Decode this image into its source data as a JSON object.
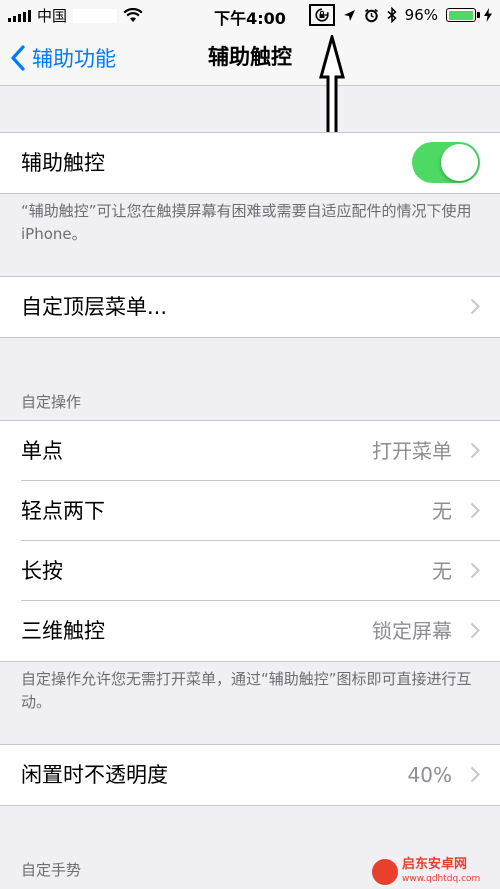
{
  "status_bar": {
    "carrier": "中国",
    "time": "下午4:00",
    "battery_percent": "96%",
    "battery_level": 0.96,
    "icons": [
      "signal-icon",
      "wifi-icon",
      "assistive-lock-icon",
      "location-icon",
      "alarm-icon",
      "bluetooth-icon",
      "battery-icon",
      "charging-icon"
    ]
  },
  "nav": {
    "back_label": "辅助功能",
    "title": "辅助触控"
  },
  "assistive_touch": {
    "label": "辅助触控",
    "enabled": true,
    "description": "“辅助触控”可让您在触摸屏幕有困难或需要自适应配件的情况下使用 iPhone。"
  },
  "top_menu": {
    "label": "自定顶层菜单..."
  },
  "custom_actions": {
    "header": "自定操作",
    "items": [
      {
        "label": "单点",
        "value": "打开菜单"
      },
      {
        "label": "轻点两下",
        "value": "无"
      },
      {
        "label": "长按",
        "value": "无"
      },
      {
        "label": "三维触控",
        "value": "锁定屏幕"
      }
    ],
    "footer": "自定操作允许您无需打开菜单，通过“辅助触控”图标即可直接进行互动。"
  },
  "idle_opacity": {
    "label": "闲置时不透明度",
    "value": "40%"
  },
  "custom_gestures": {
    "header": "自定手势"
  },
  "watermark": {
    "name": "启东安卓网",
    "url": "www.qdhtdq.com"
  },
  "colors": {
    "accent": "#007aff",
    "toggle_on": "#4cd964",
    "background": "#efeff4",
    "secondary_text": "#8e8e93"
  }
}
